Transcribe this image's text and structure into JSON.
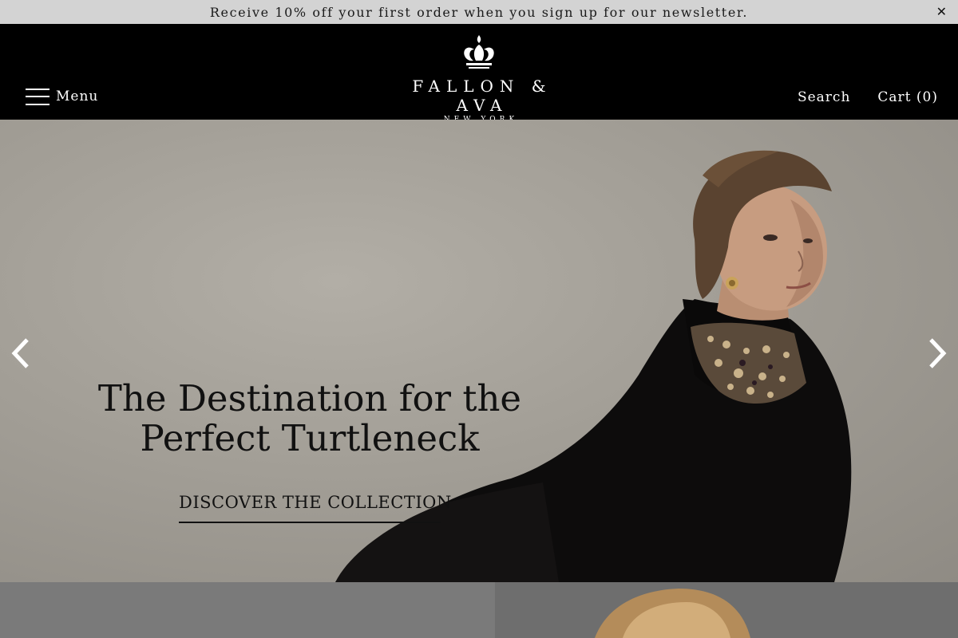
{
  "announcement": {
    "text": "Receive 10% off your first order when you sign up for our newsletter.",
    "close_glyph": "✕"
  },
  "header": {
    "menu_label": "Menu",
    "logo": {
      "name": "FALLON & AVA",
      "subtitle": "NEW YORK"
    },
    "search_label": "Search",
    "cart_label": "Cart (0)"
  },
  "hero": {
    "heading_line1": "The Destination for the",
    "heading_line2": "Perfect Turtleneck",
    "cta_label": "DISCOVER THE COLLECTION"
  },
  "icons": {
    "menu": "hamburger-icon",
    "close": "close-icon",
    "prev": "chevron-left-icon",
    "next": "chevron-right-icon",
    "logo": "crown-icon"
  },
  "colors": {
    "announcement_bg": "#d3d3d3",
    "header_bg": "#000000",
    "hero_bg": "#a29e96",
    "text_dark": "#111111"
  }
}
